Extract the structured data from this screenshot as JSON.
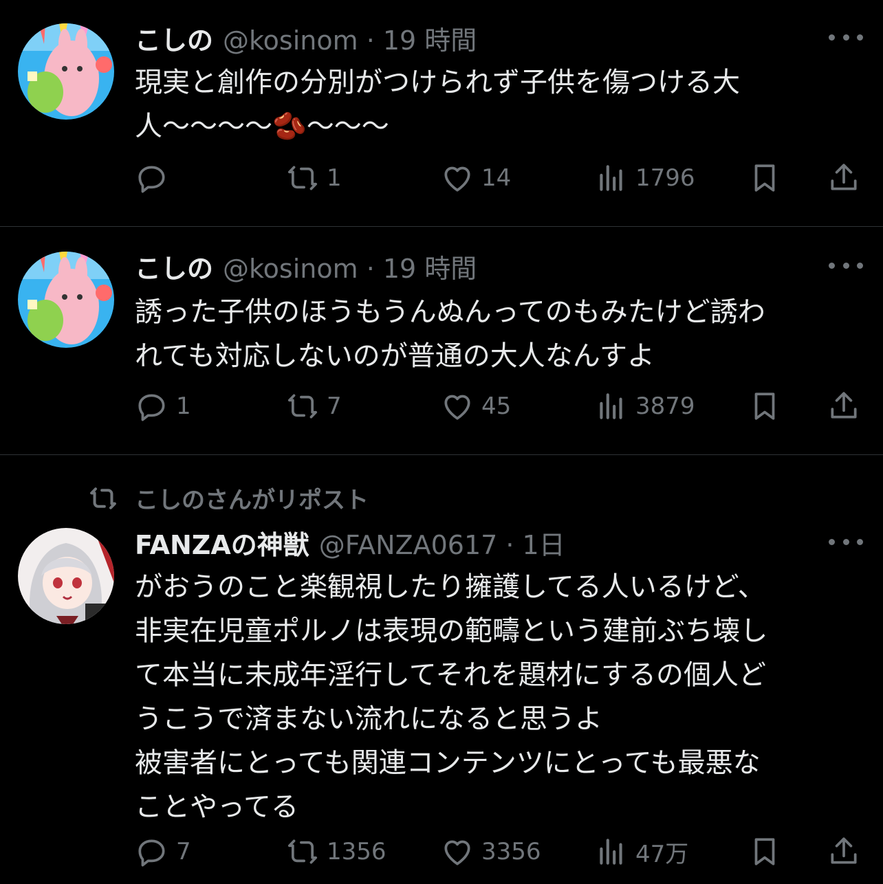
{
  "tweets": [
    {
      "name": "こしの",
      "handle": "@kosinom · 19 時間",
      "text": "現実と創作の分別がつけられず子供を傷つける大\n人〜〜〜〜🫘〜〜〜",
      "reply_count": "",
      "retweet_count": "1",
      "like_count": "14",
      "view_count": "1796"
    },
    {
      "name": "こしの",
      "handle": "@kosinom · 19 時間",
      "text": "誘った子供のほうもうんぬんってのもみたけど誘わ\nれても対応しないのが普通の大人なんすよ",
      "reply_count": "1",
      "retweet_count": "7",
      "like_count": "45",
      "view_count": "3879"
    },
    {
      "repost_note": "こしのさんがリポスト",
      "name": "FANZAの神獣",
      "handle": "@FANZA0617 · 1日",
      "text": "がおうのこと楽観視したり擁護してる人いるけど、\n非実在児童ポルノは表現の範疇という建前ぶち壊し\nて本当に未成年淫行してそれを題材にするの個人ど\nうこうで済まない流れになると思うよ\n被害者にとっても関連コンテンツにとっても最悪な\nことやってる",
      "reply_count": "7",
      "retweet_count": "1356",
      "like_count": "3356",
      "view_count": "47万"
    }
  ],
  "icons": {
    "reply": "reply-icon",
    "retweet": "retweet-icon",
    "like": "heart-icon",
    "views": "analytics-icon",
    "bookmark": "bookmark-icon",
    "share": "share-icon",
    "more": "more-icon"
  },
  "colors": {
    "background": "#000000",
    "text": "#e7e9ea",
    "secondary": "#71767b",
    "divider": "#2f3336"
  }
}
